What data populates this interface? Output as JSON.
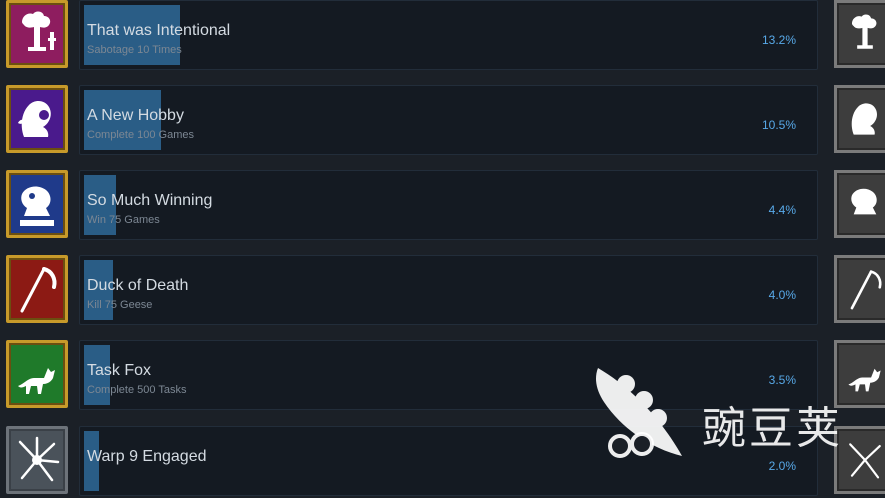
{
  "achievements": [
    {
      "name": "That was Intentional",
      "description": "Sabotage 10 Times",
      "percent": "13.2%",
      "rate": 13.2,
      "icon": "bomb-icon",
      "bg": "#8e1d5f"
    },
    {
      "name": "A New Hobby",
      "description": "Complete 100 Games",
      "percent": "10.5%",
      "rate": 10.5,
      "icon": "duck-head-icon",
      "bg": "#4a1a8c"
    },
    {
      "name": "So Much Winning",
      "description": "Win 75 Games",
      "percent": "4.4%",
      "rate": 4.4,
      "icon": "duck-trophy-icon",
      "bg": "#1f3a8a"
    },
    {
      "name": "Duck of Death",
      "description": "Kill 75 Geese",
      "percent": "4.0%",
      "rate": 4.0,
      "icon": "scythe-icon",
      "bg": "#8c1a14"
    },
    {
      "name": "Task Fox",
      "description": "Complete 500 Tasks",
      "percent": "3.5%",
      "rate": 3.5,
      "icon": "fox-icon",
      "bg": "#1f7a2a"
    },
    {
      "name": "Warp 9 Engaged",
      "description": "",
      "percent": "2.0%",
      "rate": 2.0,
      "icon": "warp-burst-icon",
      "bg": "#4a525a"
    }
  ],
  "watermark": {
    "text": "豌豆荚",
    "icon": "pea-pod-logo-icon"
  }
}
